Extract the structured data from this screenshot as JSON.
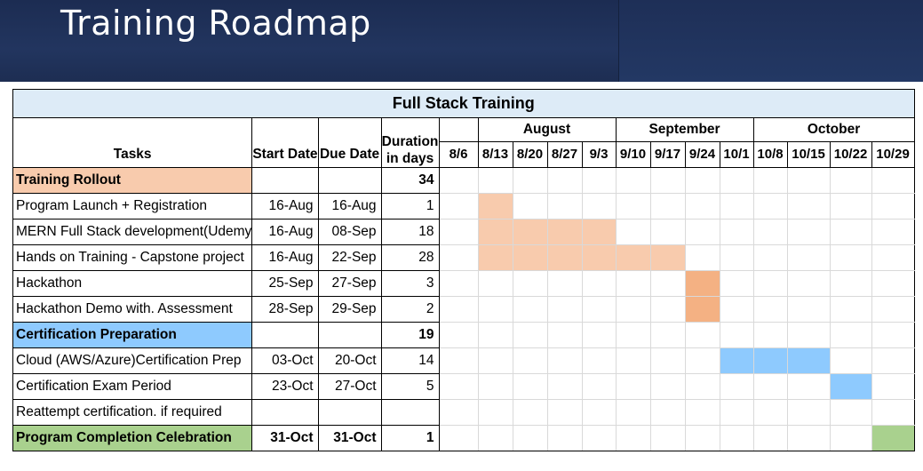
{
  "slide": {
    "title": "Training Roadmap"
  },
  "table": {
    "title": "Full Stack Training",
    "headers": {
      "tasks": "Tasks",
      "start": "Start Date",
      "due": "Due Date",
      "duration_1": "Duration",
      "duration_2": "in days"
    },
    "months": [
      "August",
      "September",
      "October"
    ],
    "weeks": [
      "8/6",
      "8/13",
      "8/20",
      "8/27",
      "9/3",
      "9/10",
      "9/17",
      "9/24",
      "10/1",
      "10/8",
      "10/15",
      "10/22",
      "10/29"
    ],
    "rows": [
      {
        "task": "Training Rollout",
        "start": "",
        "due": "",
        "duration": "34",
        "kind": "section",
        "color": "#f8cbad",
        "bar_from": -1,
        "bar_to": -1,
        "bar_color": ""
      },
      {
        "task": "Program Launch + Registration",
        "start": "16-Aug",
        "due": "16-Aug",
        "duration": "1",
        "kind": "task",
        "color": "",
        "bar_from": 1,
        "bar_to": 1,
        "bar_color": "#f8cbad"
      },
      {
        "task": "MERN Full Stack development(Udemy",
        "start": "16-Aug",
        "due": "08-Sep",
        "duration": "18",
        "kind": "task",
        "color": "",
        "bar_from": 1,
        "bar_to": 4,
        "bar_color": "#f8cbad"
      },
      {
        "task": "Hands on Training - Capstone project",
        "start": "16-Aug",
        "due": "22-Sep",
        "duration": "28",
        "kind": "task",
        "color": "",
        "bar_from": 1,
        "bar_to": 6,
        "bar_color": "#f8cbad"
      },
      {
        "task": "Hackathon",
        "start": "25-Sep",
        "due": "27-Sep",
        "duration": "3",
        "kind": "task",
        "color": "",
        "bar_from": 7,
        "bar_to": 7,
        "bar_color": "#f4b183"
      },
      {
        "task": "Hackathon Demo with. Assessment",
        "start": "28-Sep",
        "due": "29-Sep",
        "duration": "2",
        "kind": "task",
        "color": "",
        "bar_from": 7,
        "bar_to": 7,
        "bar_color": "#f4b183"
      },
      {
        "task": "Certification Preparation",
        "start": "",
        "due": "",
        "duration": "19",
        "kind": "section",
        "color": "#8ecafe",
        "bar_from": -1,
        "bar_to": -1,
        "bar_color": ""
      },
      {
        "task": "Cloud (AWS/Azure)Certification Prep",
        "start": "03-Oct",
        "due": "20-Oct",
        "duration": "14",
        "kind": "task",
        "color": "",
        "bar_from": 8,
        "bar_to": 10,
        "bar_color": "#8ecafe"
      },
      {
        "task": "Certification Exam Period",
        "start": "23-Oct",
        "due": "27-Oct",
        "duration": "5",
        "kind": "task",
        "color": "",
        "bar_from": 11,
        "bar_to": 11,
        "bar_color": "#8ecafe"
      },
      {
        "task": "Reattempt certification. if required",
        "start": "",
        "due": "",
        "duration": "",
        "kind": "task",
        "color": "",
        "bar_from": -1,
        "bar_to": -1,
        "bar_color": ""
      },
      {
        "task": "Program Completion Celebration",
        "start": "31-Oct",
        "due": "31-Oct",
        "duration": "1",
        "kind": "section",
        "color": "#a9d18e",
        "bar_from": 12,
        "bar_to": 12,
        "bar_color": "#a9d18e"
      }
    ]
  }
}
